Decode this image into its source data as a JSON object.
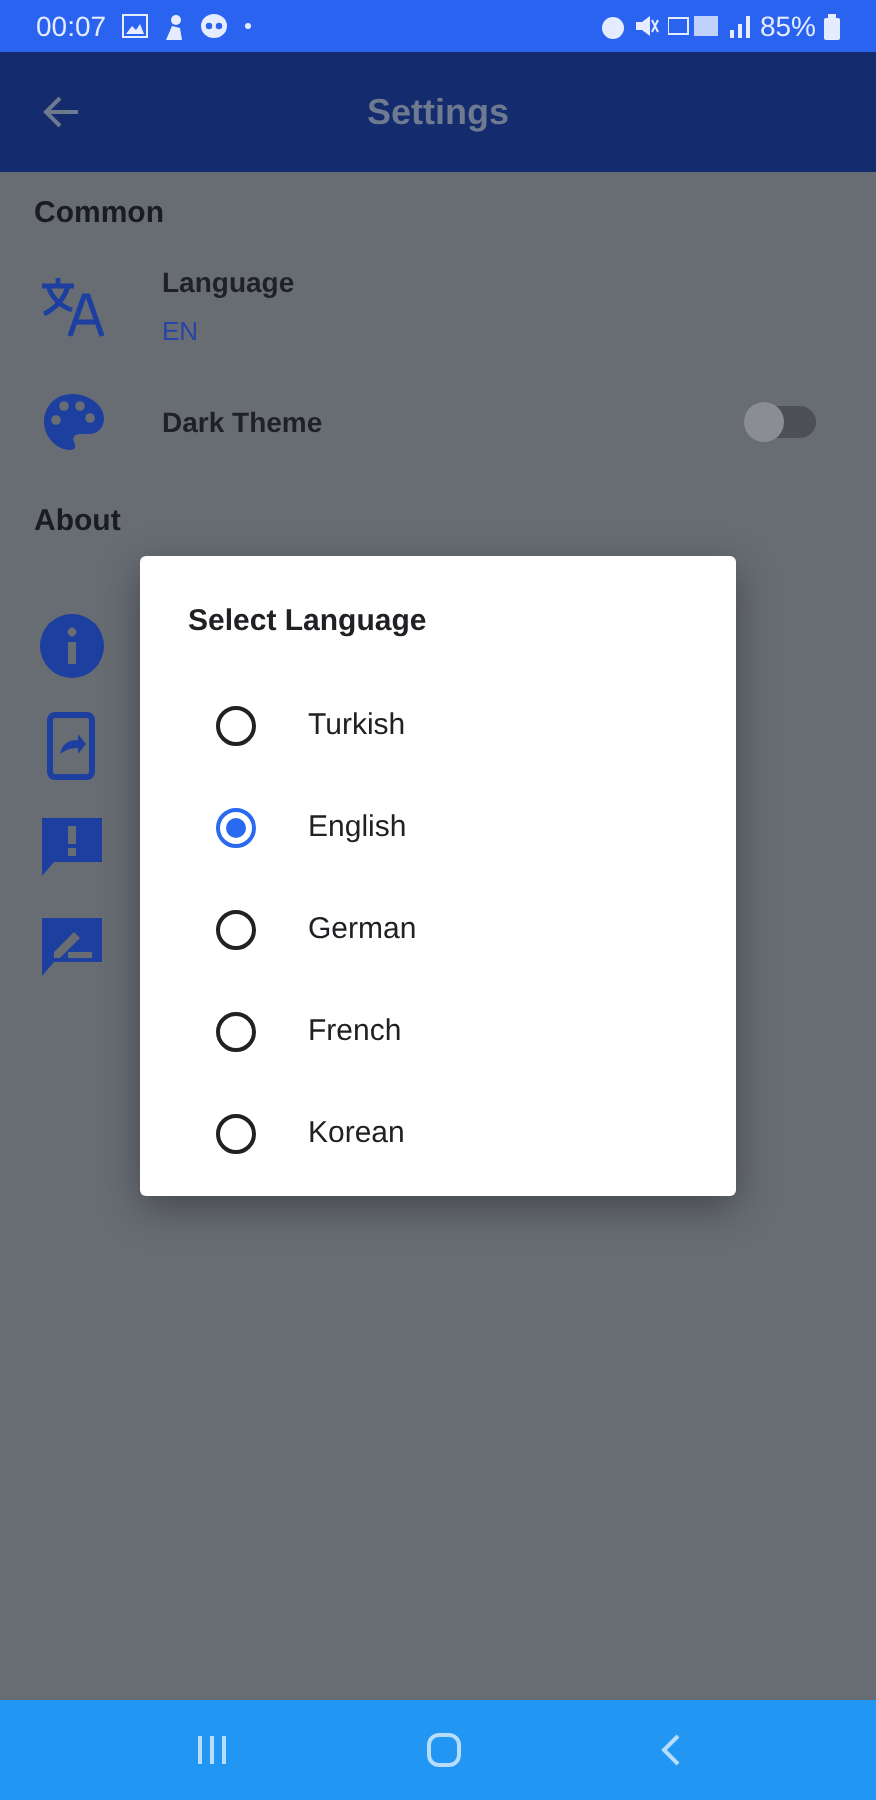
{
  "status_bar": {
    "time": "00:07",
    "battery": "85%"
  },
  "app_bar": {
    "title": "Settings"
  },
  "sections": [
    {
      "title": "Common",
      "items": [
        {
          "kind": "value",
          "label": "Language",
          "value": "EN"
        },
        {
          "kind": "toggle",
          "label": "Dark Theme",
          "on": false
        }
      ]
    },
    {
      "title": "About"
    }
  ],
  "dialog": {
    "title": "Select Language",
    "options": [
      {
        "label": "Turkish",
        "selected": false
      },
      {
        "label": "English",
        "selected": true
      },
      {
        "label": "German",
        "selected": false
      },
      {
        "label": "French",
        "selected": false
      },
      {
        "label": "Korean",
        "selected": false
      }
    ]
  }
}
